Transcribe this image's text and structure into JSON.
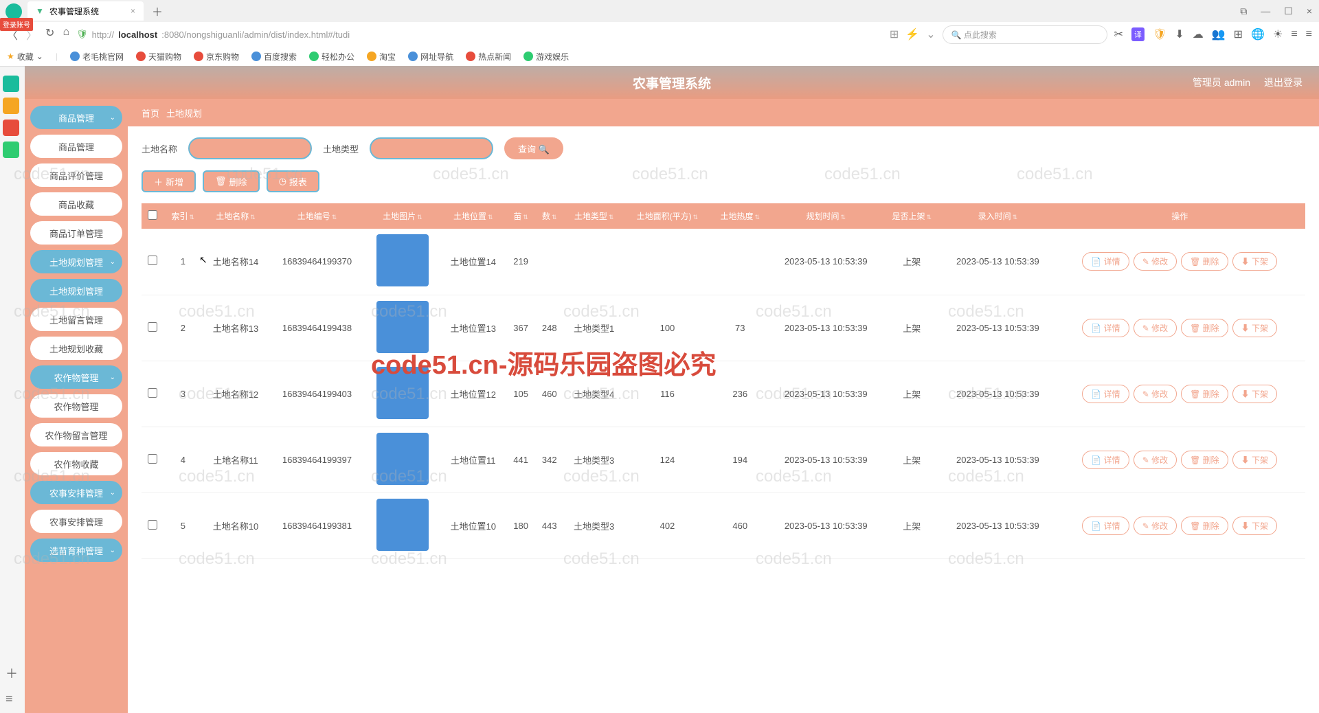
{
  "browser": {
    "tab_title": "农事管理系统",
    "url_prefix": "http://",
    "url_host": "localhost",
    "url_rest": ":8080/nongshiguanli/admin/dist/index.html#/tudi",
    "search_placeholder": "点此搜索",
    "login_badge": "登录账号"
  },
  "bookmarks": {
    "fav": "收藏",
    "items": [
      "老毛桃官网",
      "天猫购物",
      "京东购物",
      "百度搜索",
      "轻松办公",
      "淘宝",
      "网址导航",
      "热点新闻",
      "游戏娱乐"
    ]
  },
  "header": {
    "title": "农事管理系统",
    "admin": "管理员 admin",
    "logout": "退出登录"
  },
  "breadcrumb": {
    "a": "首页",
    "b": "土地规划"
  },
  "sidebar": [
    {
      "label": "商品管理",
      "type": "parent"
    },
    {
      "label": "商品管理",
      "type": "child"
    },
    {
      "label": "商品评价管理",
      "type": "child"
    },
    {
      "label": "商品收藏",
      "type": "child"
    },
    {
      "label": "商品订单管理",
      "type": "child"
    },
    {
      "label": "土地规划管理",
      "type": "parent"
    },
    {
      "label": "土地规划管理",
      "type": "active"
    },
    {
      "label": "土地留言管理",
      "type": "child"
    },
    {
      "label": "土地规划收藏",
      "type": "child"
    },
    {
      "label": "农作物管理",
      "type": "parent"
    },
    {
      "label": "农作物管理",
      "type": "child"
    },
    {
      "label": "农作物留言管理",
      "type": "child"
    },
    {
      "label": "农作物收藏",
      "type": "child"
    },
    {
      "label": "农事安排管理",
      "type": "parent"
    },
    {
      "label": "农事安排管理",
      "type": "child"
    },
    {
      "label": "选苗育种管理",
      "type": "parent"
    }
  ],
  "filters": {
    "name_label": "土地名称",
    "type_label": "土地类型",
    "query": "查询"
  },
  "actions": {
    "add": "新增",
    "delete": "删除",
    "report": "报表"
  },
  "columns": [
    "",
    "索引",
    "土地名称",
    "土地编号",
    "土地图片",
    "土地位置",
    "苗",
    "数",
    "土地类型",
    "土地面积(平方)",
    "土地热度",
    "规划时间",
    "是否上架",
    "录入时间",
    "操作"
  ],
  "row_actions": {
    "detail": "详情",
    "edit": "修改",
    "delete": "删除",
    "off": "下架"
  },
  "rows": [
    {
      "idx": "1",
      "name": "土地名称14",
      "code": "16839464199370",
      "pos": "土地位置14",
      "miao": "219",
      "shu": "",
      "type": "",
      "area": "",
      "hot": "",
      "plan": "2023-05-13 10:53:39",
      "shelf": "上架",
      "entry": "2023-05-13 10:53:39"
    },
    {
      "idx": "2",
      "name": "土地名称13",
      "code": "16839464199438",
      "pos": "土地位置13",
      "miao": "367",
      "shu": "248",
      "type": "土地类型1",
      "area": "100",
      "hot": "73",
      "plan": "2023-05-13 10:53:39",
      "shelf": "上架",
      "entry": "2023-05-13 10:53:39"
    },
    {
      "idx": "3",
      "name": "土地名称12",
      "code": "16839464199403",
      "pos": "土地位置12",
      "miao": "105",
      "shu": "460",
      "type": "土地类型4",
      "area": "116",
      "hot": "236",
      "plan": "2023-05-13 10:53:39",
      "shelf": "上架",
      "entry": "2023-05-13 10:53:39"
    },
    {
      "idx": "4",
      "name": "土地名称11",
      "code": "16839464199397",
      "pos": "土地位置11",
      "miao": "441",
      "shu": "342",
      "type": "土地类型3",
      "area": "124",
      "hot": "194",
      "plan": "2023-05-13 10:53:39",
      "shelf": "上架",
      "entry": "2023-05-13 10:53:39"
    },
    {
      "idx": "5",
      "name": "土地名称10",
      "code": "16839464199381",
      "pos": "土地位置10",
      "miao": "180",
      "shu": "443",
      "type": "土地类型3",
      "area": "402",
      "hot": "460",
      "plan": "2023-05-13 10:53:39",
      "shelf": "上架",
      "entry": "2023-05-13 10:53:39"
    }
  ],
  "watermark": "code51.cn",
  "watermark_big": "code51.cn-源码乐园盗图必究"
}
